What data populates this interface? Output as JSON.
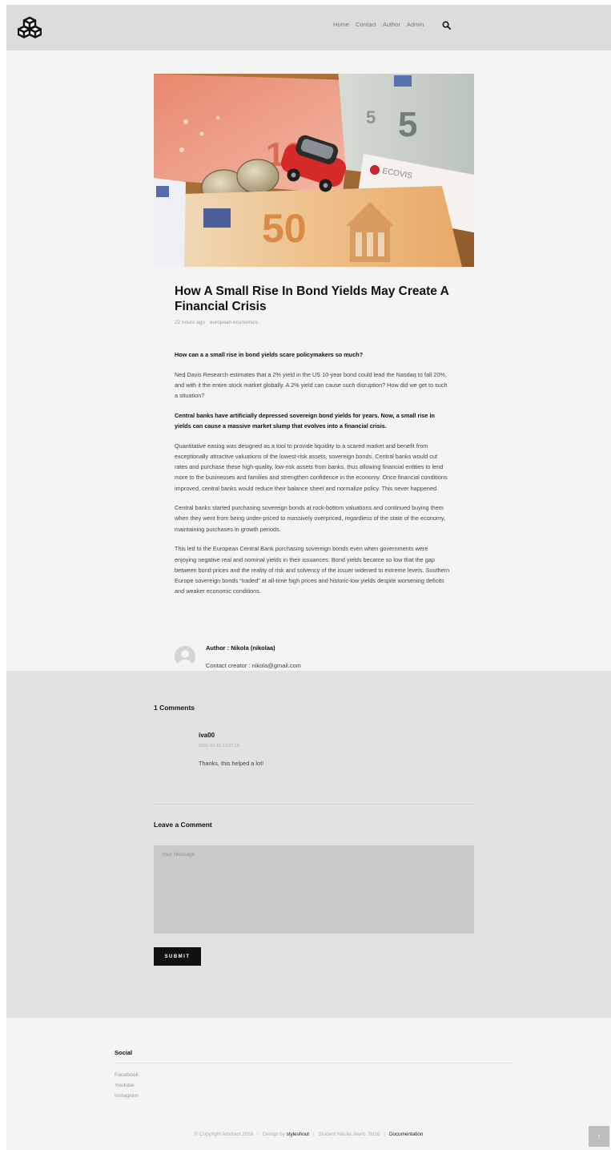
{
  "nav": {
    "items": [
      "Home",
      "Contact",
      "Author",
      "Admin"
    ]
  },
  "post": {
    "title": "How A Small Rise In Bond Yields May Create A Financial Crisis",
    "time_ago": "22 hours ago",
    "category": "european economics",
    "paragraphs": [
      "How can a a small rise in bond yields scare policymakers so much?",
      "Ned Davis Research estimates that a 2% yield in the US 10-year bond could lead the Nasdaq to fall 20%, and with it the entire stock market globally. A 2% yield can cause such disruption? How did we get to such a situation?",
      "Central banks have artificially depressed sovereign bond yields for years. Now, a small rise in yields can cause a massive market slump that evolves into a financial crisis.",
      "Quantitative easing was designed as a tool to provide liquidity to a scared market and benefit from exceptionally attractive valuations of the lowest-risk assets, sovereign bonds. Central banks would cut rates and purchase these high-quality, low-risk assets from banks, thus allowing financial entities to lend more to the businesses and families and strengthen confidence in the economy. Once financial conditions improved, central banks would reduce their balance sheet and normalize policy. This never happened.",
      "Central banks started purchasing sovereign bonds at rock-bottom valuations and continued buying them when they went from being under-priced to massively overpriced, regardless of the state of the economy, maintaining purchases in growth periods.",
      "This led to the European Central Bank purchasing sovereign bonds even when governments were enjoying negative real and nominal yields in their issuances. Bond yields became so low that the gap between bond prices and the reality of risk and solvency of the issuer widened to extreme levels. Southern Europe sovereign bonds “traded” at all-time high prices and historic-low yields despite worsening deficits and weaker economic conditions."
    ],
    "author": "Author : Nikola (nikolaa)",
    "contact": "Contact creator : nikola@gmail.com"
  },
  "comments": {
    "count_label": "1 Comments",
    "items": [
      {
        "author": "iva00",
        "date": "2021-03-15 21:07:18",
        "text": "Thanks, this helped a lot!"
      }
    ],
    "leave_title": "Leave a Comment",
    "message_placeholder": "Your Message",
    "submit_label": "SUBMIT"
  },
  "footer": {
    "social_title": "Social",
    "social_links": [
      "Facebook",
      "Youtube",
      "Instagram"
    ],
    "copyright": "© Copyright Abstract 2016",
    "design_by": "Design by",
    "designer": "styleshout",
    "student": "Student Nikola Jevric 78/18",
    "documentation": "Documentation",
    "to_top": "↑"
  }
}
